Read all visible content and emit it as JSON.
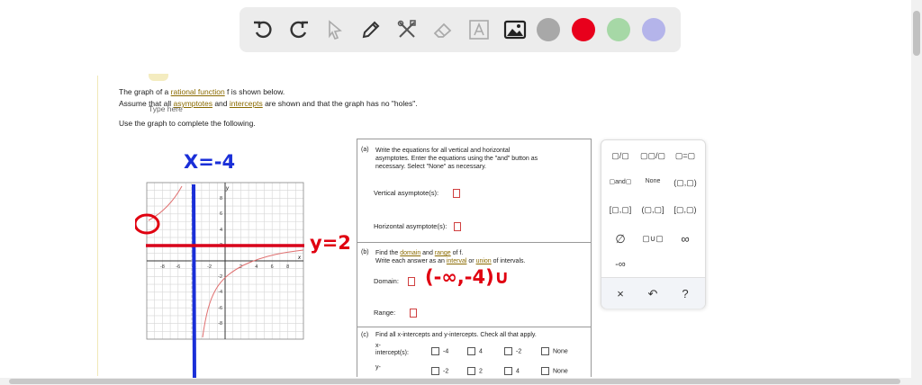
{
  "toolbar": {
    "tools": [
      "undo-icon",
      "redo-icon",
      "pointer-icon",
      "pen-icon",
      "tools-icon",
      "eraser-icon",
      "text-icon",
      "image-icon"
    ],
    "colors": [
      "#a8a8a8",
      "#e8001c",
      "#a6d8a6",
      "#b4b4ea"
    ]
  },
  "problem": {
    "line1_pre": "The graph of a ",
    "line1_link": "rational function",
    "line1_post": " f is shown below.",
    "line2_pre": "Assume that all ",
    "line2_link1": "asymptotes",
    "line2_mid": " and ",
    "line2_link2": "intercepts",
    "line2_post": " are shown and that the graph has no \"holes\".",
    "line3": "Use the graph to complete the following.",
    "overlay": "Type here"
  },
  "graph": {
    "x_ticks": [
      "-8",
      "-6",
      "-4",
      "-2",
      "2",
      "4",
      "6",
      "8"
    ],
    "y_ticks": [
      "8",
      "6",
      "4",
      "2",
      "-2",
      "-4",
      "-6",
      "-8"
    ],
    "x_label": "x",
    "y_label": "y"
  },
  "part_a": {
    "label": "(a)",
    "text1": "Write the equations for all vertical and horizontal",
    "text2": "asymptotes. Enter the equations using the \"and\" button as",
    "text3": "necessary. Select \"None\" as necessary.",
    "vertical": "Vertical asymptote(s):",
    "horizontal": "Horizontal asymptote(s):"
  },
  "part_b": {
    "label": "(b)",
    "text1_pre": "Find the ",
    "text1_link1": "domain",
    "text1_mid": " and ",
    "text1_link2": "range",
    "text1_post": " of f.",
    "text2_pre": "Write each answer as an ",
    "text2_link1": "interval",
    "text2_mid": " or ",
    "text2_link2": "union",
    "text2_post": " of intervals.",
    "domain": "Domain:",
    "range": "Range:"
  },
  "part_c": {
    "label": "(c)",
    "text": "Find all x-intercepts and y-intercepts. Check all that apply.",
    "x_label_1": "x-",
    "x_label_2": "intercept(s):",
    "y_label_1": "y-",
    "x_options": [
      "-4",
      "4",
      "-2",
      "None"
    ],
    "y_options": [
      "-2",
      "2",
      "4",
      "None"
    ]
  },
  "palette": {
    "row1": [
      "▢/▢",
      "▢▢/▢",
      "▢=▢"
    ],
    "row2": [
      "▢and▢",
      "None",
      "(▢,▢)"
    ],
    "row3": [
      "[▢,▢]",
      "(▢,▢]",
      "[▢,▢)"
    ],
    "row4": [
      "∅",
      "▢∪▢",
      "∞"
    ],
    "row5": [
      "-∞"
    ],
    "actions": [
      "×",
      "↶",
      "?"
    ]
  },
  "annotations": {
    "vertical": "X=-4",
    "horizontal": "y=2",
    "domain": "(-∞,-4)∪"
  }
}
